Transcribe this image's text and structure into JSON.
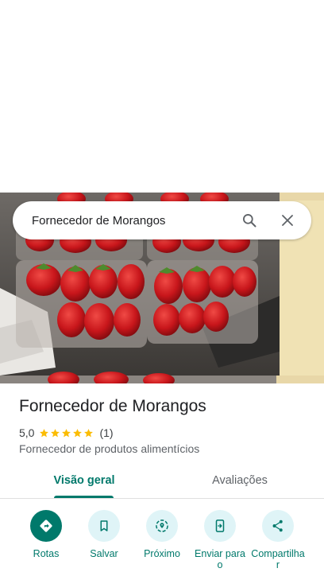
{
  "search": {
    "query": "Fornecedor de Morangos"
  },
  "place": {
    "name": "Fornecedor de Morangos",
    "rating": "5,0",
    "stars": 5,
    "review_count": "(1)",
    "category": "Fornecedor de produtos alimentícios"
  },
  "tabs": [
    "Visão geral",
    "Avaliações"
  ],
  "actions": [
    {
      "label": "Rotas",
      "icon": "directions-icon"
    },
    {
      "label": "Salvar",
      "icon": "bookmark-icon"
    },
    {
      "label": "Próximo",
      "icon": "nearby-icon"
    },
    {
      "label": "Enviar para o",
      "icon": "send-to-phone-icon"
    },
    {
      "label": "Compartilhar",
      "icon": "share-icon"
    }
  ],
  "colors": {
    "accent": "#00796b",
    "button_bg": "#dff4f7",
    "star": "#fbbc04"
  }
}
